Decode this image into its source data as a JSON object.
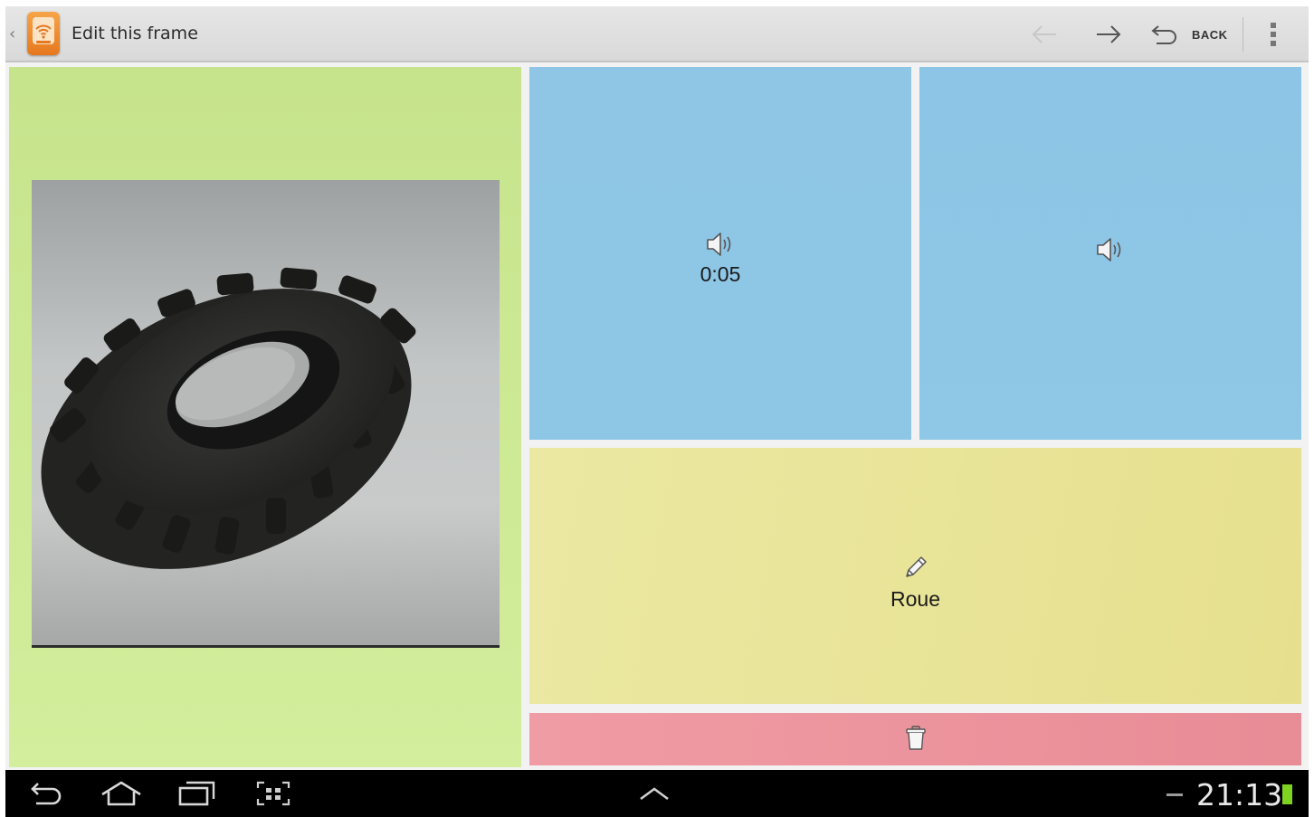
{
  "action_bar": {
    "title": "Edit this frame",
    "up_icon": "chevron-left-icon",
    "app_icon": "app-wifi-phone-icon",
    "prev_icon": "arrow-left-icon",
    "next_icon": "arrow-right-icon",
    "back_icon": "undo-icon",
    "back_label": "BACK",
    "overflow_icon": "overflow-menu-icon"
  },
  "frame": {
    "image_panel": {
      "image_description": "photo of a black toy tyre",
      "color": "#c9e68f"
    },
    "audio_panels": [
      {
        "icon": "speaker-icon",
        "duration": "0:05",
        "color": "#8ec6e6"
      },
      {
        "icon": "speaker-icon",
        "duration": "",
        "color": "#8ec6e6"
      }
    ],
    "text_panel": {
      "icon": "pencil-icon",
      "text": "Roue",
      "color": "#e8e398"
    },
    "delete_panel": {
      "icon": "trash-icon",
      "color": "#ec949d"
    }
  },
  "system_bar": {
    "back_icon": "nav-back-icon",
    "home_icon": "nav-home-icon",
    "recents_icon": "nav-recents-icon",
    "screenshot_icon": "screenshot-icon",
    "up_icon": "chevron-up-icon",
    "clock": "21:13",
    "battery_color": "#7ed321"
  }
}
